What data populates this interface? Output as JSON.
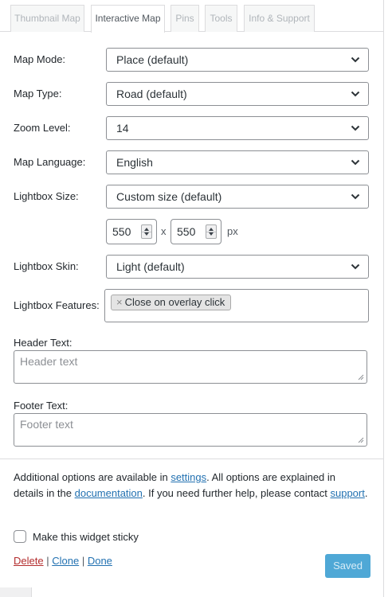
{
  "tabs": [
    {
      "label": "Thumbnail Map",
      "active": false
    },
    {
      "label": "Interactive Map",
      "active": true
    },
    {
      "label": "Pins",
      "active": false
    },
    {
      "label": "Tools",
      "active": false
    },
    {
      "label": "Info & Support",
      "active": false
    }
  ],
  "form": {
    "map_mode": {
      "label": "Map Mode:",
      "value": "Place (default)"
    },
    "map_type": {
      "label": "Map Type:",
      "value": "Road (default)"
    },
    "zoom_level": {
      "label": "Zoom Level:",
      "value": "14"
    },
    "map_language": {
      "label": "Map Language:",
      "value": "English"
    },
    "lightbox_size": {
      "label": "Lightbox Size:",
      "value": "Custom size (default)"
    },
    "lightbox_dims": {
      "width": "550",
      "separator": "x",
      "height": "550",
      "unit": "px"
    },
    "lightbox_skin": {
      "label": "Lightbox Skin:",
      "value": "Light (default)"
    },
    "lightbox_features": {
      "label": "Lightbox Features:",
      "remove_symbol": "×",
      "tag": "Close on overlay click"
    },
    "header_text": {
      "label": "Header Text:",
      "placeholder": "Header text"
    },
    "footer_text": {
      "label": "Footer Text:",
      "placeholder": "Footer text"
    }
  },
  "help": {
    "part1": "Additional options are available in ",
    "settings_link": "settings",
    "part2": ". All options are explained in details in the ",
    "documentation_link": "documentation",
    "part3": ". If you need further help, please contact ",
    "support_link": "support",
    "part4": "."
  },
  "sticky": {
    "label": "Make this widget sticky",
    "checked": false
  },
  "actions": {
    "delete": "Delete",
    "sep": "|",
    "clone": "Clone",
    "done": "Done"
  },
  "save_button": "Saved",
  "colors": {
    "link": "#2271b1",
    "delete": "#b32d2e",
    "saved_button": "#4fa8d6"
  }
}
